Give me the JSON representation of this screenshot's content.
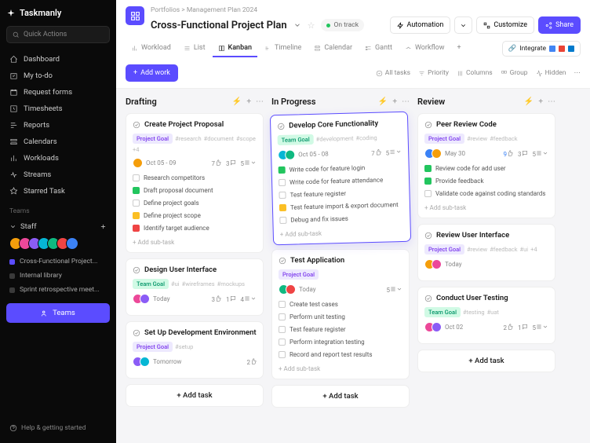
{
  "brand": "Taskmanly",
  "search_placeholder": "Quick Actions",
  "nav": [
    "Dashboard",
    "My to-do",
    "Request forms",
    "Timesheets",
    "Reports",
    "Calendars",
    "Workloads",
    "Streams",
    "Starred Task"
  ],
  "teams_label": "Teams",
  "staff_label": "Staff",
  "projects": [
    {
      "color": "#5b4cff",
      "name": "Cross-Functional Project..."
    },
    {
      "color": "#3a3a3a",
      "name": "Internal library"
    },
    {
      "color": "#3a3a3a",
      "name": "Sprint retrospective meet..."
    }
  ],
  "teams_btn": "Teams",
  "help": "Help & getting started",
  "breadcrumb": "Portfolios > Management Plan 2024",
  "title": "Cross-Functional Project Plan",
  "status": "On track",
  "hdr_btns": {
    "automation": "Automation",
    "customize": "Customize",
    "share": "Share"
  },
  "tabs": [
    "Workload",
    "List",
    "Kanban",
    "Timeline",
    "Calendar",
    "Gantt",
    "Workflow"
  ],
  "integrate": "Integrate",
  "add_work": "Add work",
  "toolbar": [
    "All tasks",
    "Priority",
    "Columns",
    "Group",
    "Hidden"
  ],
  "columns": [
    {
      "title": "Drafting",
      "cards": [
        {
          "title": "Create Project Proposal",
          "badge": {
            "type": "purple",
            "text": "Project Goal"
          },
          "tags": [
            "#research",
            "#document",
            "#scope",
            "+4"
          ],
          "date": "Oct 05 - 09",
          "stats": {
            "likes": 7,
            "comments": 3,
            "tasks": "5"
          },
          "subtasks": [
            {
              "done": "",
              "text": "Research competitors"
            },
            {
              "done": "done",
              "text": "Draft proposal document"
            },
            {
              "done": "",
              "text": "Define project goals"
            },
            {
              "done": "y",
              "text": "Define project scope"
            },
            {
              "done": "r",
              "text": "Identify target audience"
            }
          ]
        },
        {
          "title": "Design User Interface",
          "badge": {
            "type": "green",
            "text": "Team Goal"
          },
          "tags": [
            "#ui",
            "#wireframes",
            "#mockups"
          ],
          "date": "Today",
          "stats": {
            "likes": 3,
            "comments": 1,
            "tasks": "4"
          }
        },
        {
          "title": "Set Up Development Environment",
          "badge": {
            "type": "purple",
            "text": "Project Goal"
          },
          "tags": [
            "#setup"
          ],
          "date": "Tomorrow",
          "stats": {
            "likes": 2,
            "comments": null,
            "tasks": null
          }
        }
      ]
    },
    {
      "title": "In Progress",
      "cards": [
        {
          "highlight": true,
          "title": "Develop Core Functionality",
          "badge": {
            "type": "green",
            "text": "Team Goal"
          },
          "tags": [
            "#development",
            "#coding"
          ],
          "date": "Oct 05 - 08",
          "stats": {
            "likes": 7,
            "comments": null,
            "tasks": "5"
          },
          "subtasks": [
            {
              "done": "done",
              "text": "Write code for feature login"
            },
            {
              "done": "",
              "text": "Write code for feature attendance"
            },
            {
              "done": "",
              "text": "Test feature register"
            },
            {
              "done": "y",
              "text": "Test feature import & export document"
            },
            {
              "done": "",
              "text": "Debug and fix issues"
            }
          ]
        },
        {
          "title": "Test Application",
          "badge": {
            "type": "purple",
            "text": "Project Goal"
          },
          "tags": [],
          "date": "Today",
          "stats": {
            "likes": null,
            "comments": null,
            "tasks": "5"
          },
          "subtasks": [
            {
              "done": "",
              "text": "Create test cases"
            },
            {
              "done": "",
              "text": "Perform unit testing"
            },
            {
              "done": "",
              "text": "Test feature register"
            },
            {
              "done": "",
              "text": "Perform integration testing"
            },
            {
              "done": "",
              "text": "Record and report test results"
            }
          ]
        }
      ]
    },
    {
      "title": "Review",
      "cards": [
        {
          "title": "Peer Review Code",
          "badge": {
            "type": "purple",
            "text": "Project Goal"
          },
          "tags": [
            "#review",
            "#feedback"
          ],
          "date": "May 30",
          "stats": {
            "likes": 9,
            "comments": 3,
            "tasks": "5",
            "like_blue": true
          },
          "subtasks": [
            {
              "done": "done",
              "text": "Review code for add user"
            },
            {
              "done": "done",
              "text": "Provide feedback"
            },
            {
              "done": "",
              "text": "Validate code against coding standards"
            }
          ]
        },
        {
          "title": "Review User Interface",
          "badge": {
            "type": "purple",
            "text": "Project Goal"
          },
          "tags": [
            "#review",
            "#feedback",
            "#ui",
            "+4"
          ],
          "date": "Today"
        },
        {
          "title": "Conduct User Testing",
          "badge": {
            "type": "green",
            "text": "Team Goal"
          },
          "tags": [
            "#testing",
            "#uat"
          ],
          "date": "Oct 02",
          "stats": {
            "likes": 2,
            "comments": 1,
            "tasks": "5"
          }
        }
      ]
    }
  ],
  "add_subtask": "Add sub-task",
  "add_task": "Add task",
  "avatar_colors": [
    "#f59e0b",
    "#ec4899",
    "#8b5cf6",
    "#06b6d4",
    "#10b981",
    "#ef4444",
    "#3b82f6"
  ]
}
